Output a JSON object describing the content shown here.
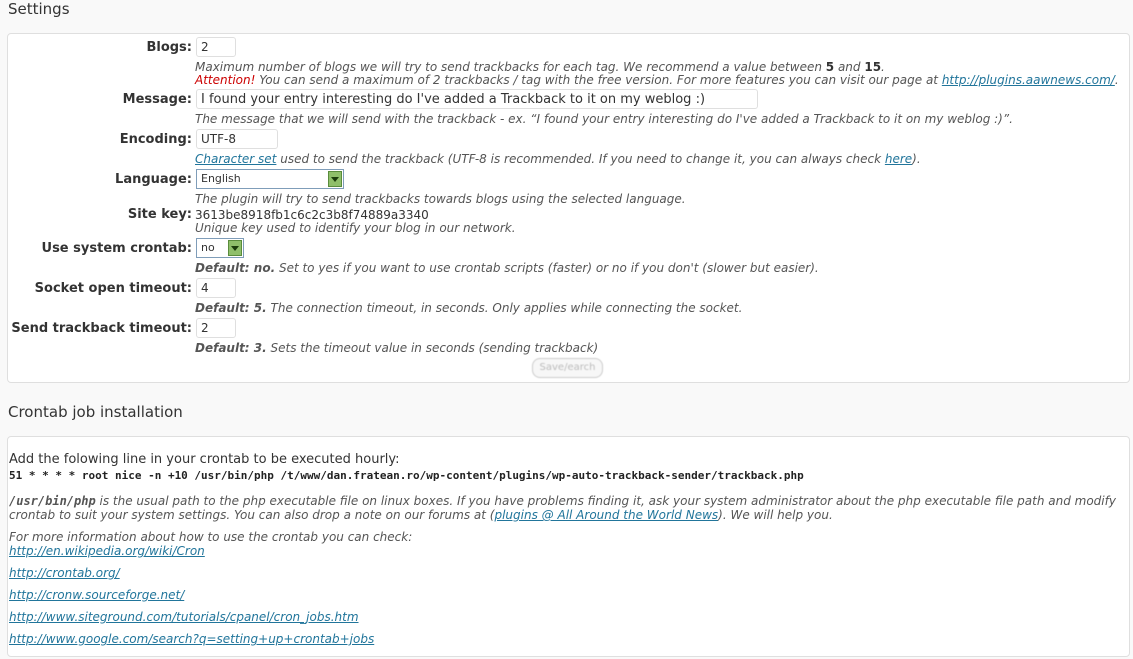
{
  "settings": {
    "title": "Settings",
    "blogs": {
      "label": "Blogs:",
      "value": "2",
      "note_pre": "Maximum number of blogs we will try to send trackbacks for each tag. We recommend a value between ",
      "note_min": "5",
      "note_mid": " and ",
      "note_max": "15",
      "note_end": ".",
      "attention": "Attention!",
      "attention_text": " You can send a maximum of 2 trackbacks / tag with the free version. For more features you can visit our page at ",
      "attention_link": "http://plugins.aawnews.com/",
      "attention_end": "."
    },
    "message": {
      "label": "Message:",
      "value": "I found your entry interesting do I've added a Trackback to it on my weblog :)",
      "note": "The message that we will send with the trackback - ex. “I found your entry interesting do I've added a Trackback to it on my weblog :)”."
    },
    "encoding": {
      "label": "Encoding:",
      "value": "UTF-8",
      "link1": "Character set",
      "note_mid": " used to send the trackback (UTF-8 is recommended. If you need to change it, you can always check ",
      "link2": "here",
      "note_end": ")."
    },
    "language": {
      "label": "Language:",
      "selected": "English",
      "note": "The plugin will try to send trackbacks towards blogs using the selected language."
    },
    "site_key": {
      "label": "Site key:",
      "value": "3613be8918fb1c6c2c3b8f74889a3340",
      "note": "Unique key used to identify your blog in our network."
    },
    "crontab": {
      "label": "Use system crontab:",
      "selected": "no",
      "default": "Default: no.",
      "note": " Set to yes if you want to use crontab scripts (faster) or no if you don't (slower but easier)."
    },
    "socket_timeout": {
      "label": "Socket open timeout:",
      "value": "4",
      "default": "Default: 5.",
      "note": " The connection timeout, in seconds. Only applies while connecting the socket."
    },
    "send_timeout": {
      "label": "Send trackback timeout:",
      "value": "2",
      "default": "Default: 3.",
      "note": " Sets the timeout value in seconds (sending trackback)"
    },
    "save_button": "Save/earch"
  },
  "crontab_install": {
    "title": "Crontab job installation",
    "intro": "Add the folowing line in your crontab to be executed hourly:",
    "command": "51 * * * * root nice -n +10 /usr/bin/php /t/www/dan.fratean.ro/wp-content/plugins/wp-auto-trackback-sender/trackback.php",
    "php_path": "/usr/bin/php",
    "php_note": " is the usual path to the php executable file on linux boxes. If you have problems finding it, ask your system administrator about the php executable file path and modify crontab to suit your system settings. You can also drop a note on our forums at (",
    "forum_link": "plugins @ All Around the World News",
    "php_note_end": "). We will help you.",
    "more_info": "For more information about how to use the crontab you can check:",
    "links": [
      "http://en.wikipedia.org/wiki/Cron",
      "http://crontab.org/",
      "http://cronw.sourceforge.net/",
      "http://www.siteground.com/tutorials/cpanel/cron_jobs.htm",
      "http://www.google.com/search?q=setting+up+crontab+jobs"
    ]
  }
}
